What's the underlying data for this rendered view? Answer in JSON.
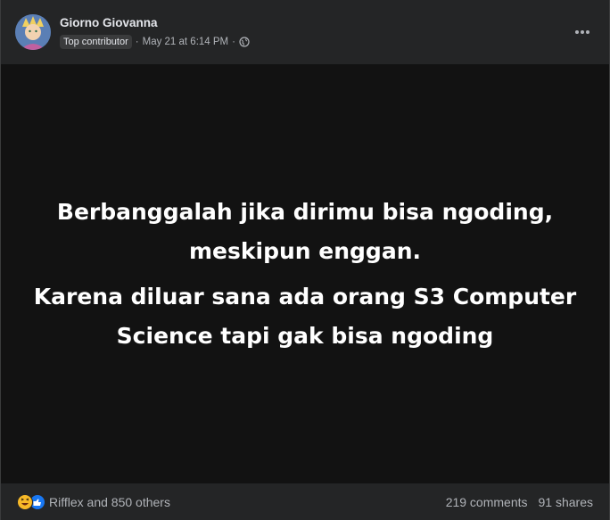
{
  "post": {
    "author": "Giorno Giovanna",
    "badge": "Top contributor",
    "separator": "·",
    "timestamp": "May 21 at 6:14 PM",
    "separator2": "·",
    "audience_icon": "globe-icon"
  },
  "image": {
    "line1": "Berbanggalah jika dirimu bisa ngoding,",
    "line2": "meskipun enggan.",
    "line3": "Karena diluar sana ada orang S3 Computer",
    "line4": "Science tapi gak bisa ngoding"
  },
  "footer": {
    "reactions_text": "Rifflex and 850 others",
    "comments": "219 comments",
    "shares": "91 shares"
  },
  "colors": {
    "background": "#242526",
    "image_bg": "#121212",
    "like_blue": "#1877f2",
    "haha_yellow": "#f7b928"
  }
}
